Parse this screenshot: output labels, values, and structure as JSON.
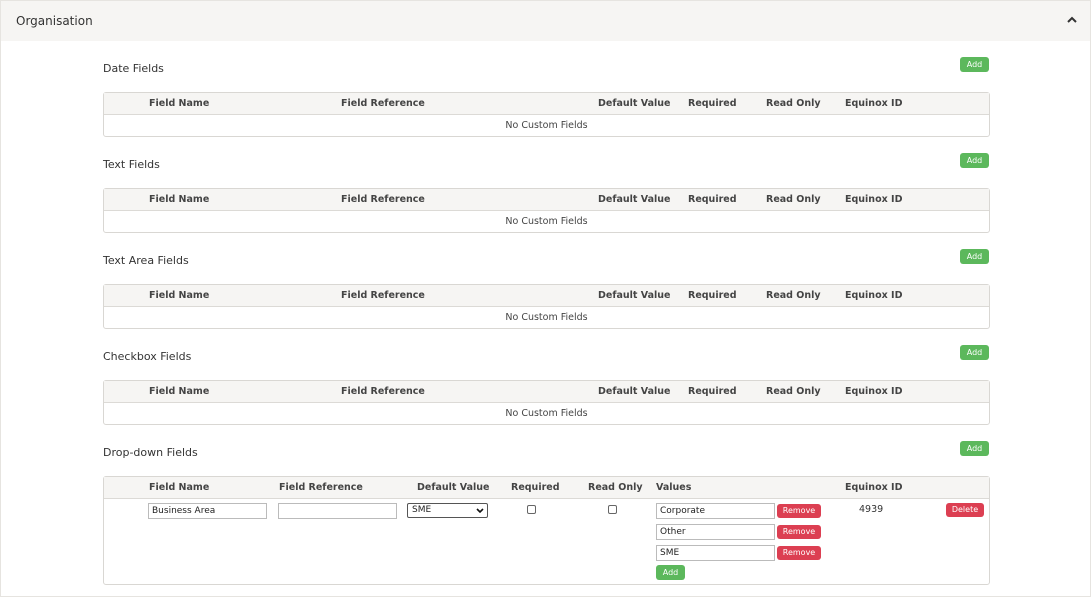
{
  "panel": {
    "title": "Organisation"
  },
  "columns": {
    "field_name": "Field Name",
    "field_reference": "Field Reference",
    "default_value": "Default Value",
    "required": "Required",
    "read_only": "Read Only",
    "equinox_id": "Equinox ID",
    "values": "Values"
  },
  "empty_text": "No Custom Fields",
  "add_label": "Add",
  "sections": {
    "date": {
      "title": "Date Fields"
    },
    "text": {
      "title": "Text Fields"
    },
    "textarea": {
      "title": "Text Area Fields"
    },
    "checkbox": {
      "title": "Checkbox Fields"
    },
    "dropdown": {
      "title": "Drop-down Fields"
    }
  },
  "dropdown_row": {
    "field_name": "Business Area",
    "field_reference": "",
    "default_value": "SME",
    "required": false,
    "read_only": false,
    "values": [
      "Corporate",
      "Other",
      "SME"
    ],
    "remove_label": "Remove",
    "add_label": "Add",
    "equinox_id": "4939",
    "delete_label": "Delete"
  },
  "colors": {
    "add_green": "#5cb85c",
    "remove_red": "#dc3f52",
    "header_bg": "#f6f5f3"
  }
}
